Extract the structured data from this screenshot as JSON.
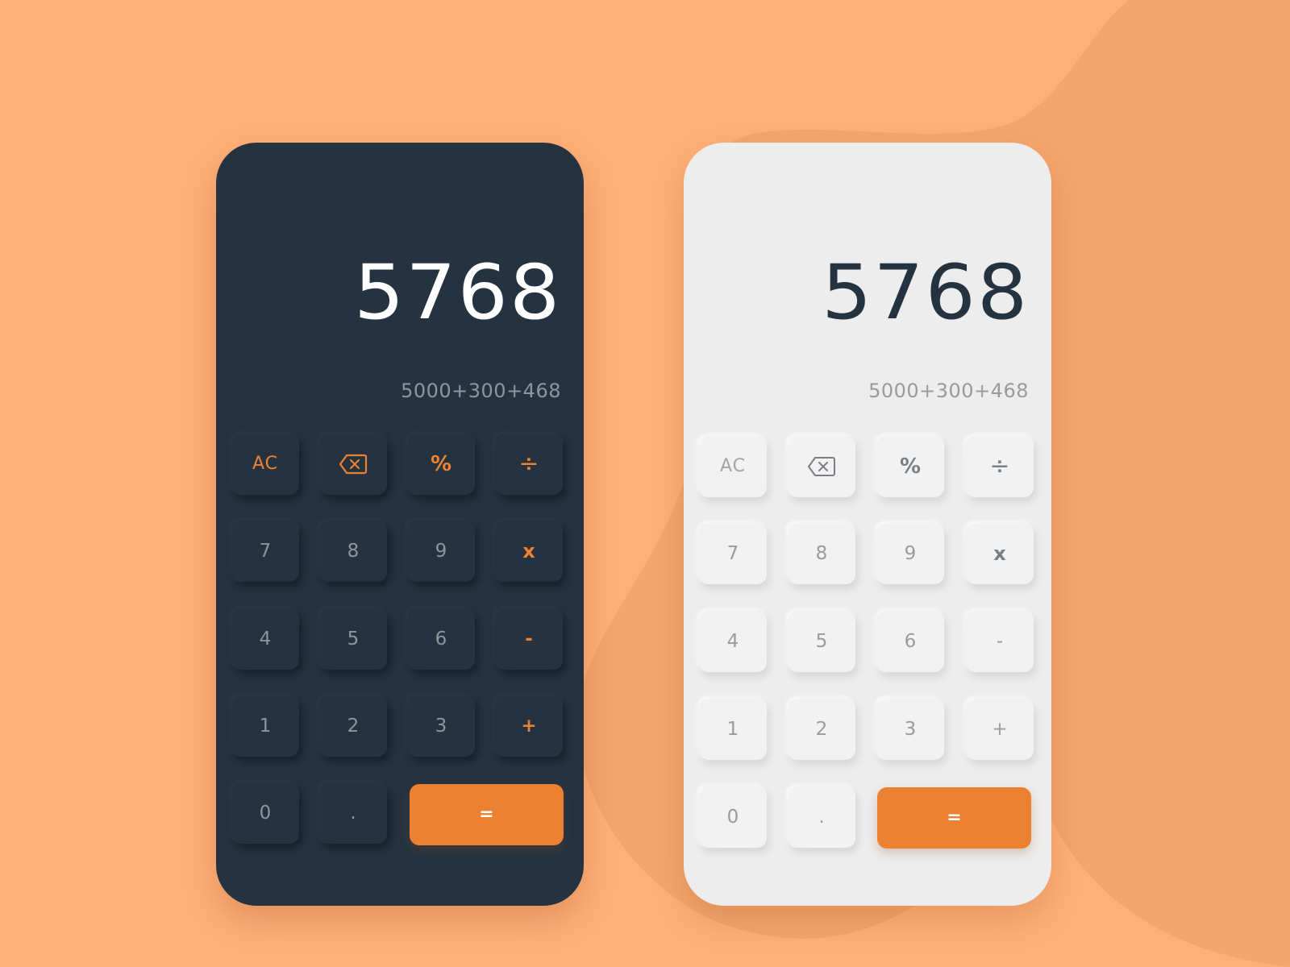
{
  "colors": {
    "background": "#FFB078",
    "background_blob": "#F4A66E",
    "dark_panel": "#253341",
    "light_panel": "#EDEDED",
    "accent": "#EC8132",
    "dark_key_text": "#8E959D",
    "light_key_text": "#9B9B9B"
  },
  "dark_calculator": {
    "result": "5768",
    "expression": "5000+300+468",
    "keys": {
      "ac": "AC",
      "backspace_icon": "backspace-icon",
      "percent": "%",
      "divide": "÷",
      "seven": "7",
      "eight": "8",
      "nine": "9",
      "multiply": "x",
      "four": "4",
      "five": "5",
      "six": "6",
      "minus": "-",
      "one": "1",
      "two": "2",
      "three": "3",
      "plus": "+",
      "zero": "0",
      "decimal": ".",
      "equals": "="
    }
  },
  "light_calculator": {
    "result": "5768",
    "expression": "5000+300+468",
    "keys": {
      "ac": "AC",
      "backspace_icon": "backspace-icon",
      "percent": "%",
      "divide": "÷",
      "seven": "7",
      "eight": "8",
      "nine": "9",
      "multiply": "x",
      "four": "4",
      "five": "5",
      "six": "6",
      "minus": "-",
      "one": "1",
      "two": "2",
      "three": "3",
      "plus": "+",
      "zero": "0",
      "decimal": ".",
      "equals": "="
    }
  }
}
